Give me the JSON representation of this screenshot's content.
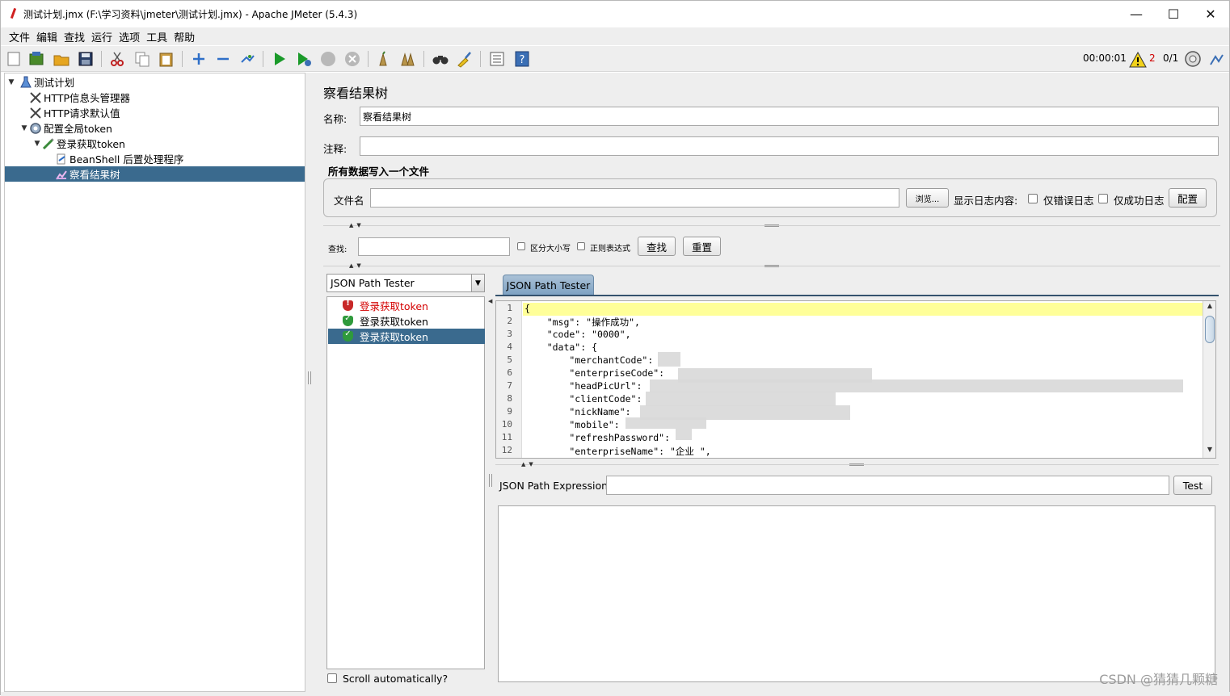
{
  "window": {
    "title": "测试计划.jmx (F:\\学习资料\\jmeter\\测试计划.jmx) - Apache JMeter (5.4.3)",
    "minimize": "—",
    "maximize": "☐",
    "close": "✕"
  },
  "menubar": [
    "文件",
    "编辑",
    "查找",
    "运行",
    "选项",
    "工具",
    "帮助"
  ],
  "toolbar": {
    "icons": [
      "new-icon",
      "templates-icon",
      "open-icon",
      "save-icon",
      "cut-icon",
      "copy-icon",
      "paste-icon",
      "expand-icon",
      "collapse-icon",
      "toggle-icon",
      "start-icon",
      "start-no-pause-icon",
      "stop-icon",
      "shutdown-icon",
      "clear-icon",
      "clear-all-icon",
      "search-icon",
      "reset-search-icon",
      "function-helper-icon",
      "help-icon"
    ],
    "timer": "00:00:01",
    "warning_count": "2",
    "threads": "0/1",
    "colors": {
      "run_green": "#1a9a2a",
      "selection": "#3a6a8e",
      "error_red": "#d40000"
    }
  },
  "tree": [
    {
      "label": "测试计划",
      "icon": "test-plan-icon",
      "toggle": "▼",
      "level": 0
    },
    {
      "label": "HTTP信息头管理器",
      "icon": "config-tool-icon",
      "toggle": "",
      "level": 1
    },
    {
      "label": "HTTP请求默认值",
      "icon": "config-tool-icon",
      "toggle": "",
      "level": 1
    },
    {
      "label": "配置全局token",
      "icon": "gear-icon",
      "toggle": "▼",
      "level": 1
    },
    {
      "label": "登录获取token",
      "icon": "sampler-icon",
      "toggle": "▼",
      "level": 2
    },
    {
      "label": "BeanShell 后置处理程序",
      "icon": "post-processor-icon",
      "toggle": "",
      "level": 3
    },
    {
      "label": "察看结果树",
      "icon": "listener-icon",
      "toggle": "",
      "level": 3,
      "selected": true
    }
  ],
  "panel": {
    "title": "察看结果树",
    "name_label": "名称:",
    "name_value": "察看结果树",
    "comment_label": "注释:",
    "comment_value": "",
    "file_group_title": "所有数据写入一个文件",
    "filename_label": "文件名",
    "filename_value": "",
    "browse_button": "浏览...",
    "log_content_label": "显示日志内容:",
    "errors_only_label": "仅错误日志",
    "success_only_label": "仅成功日志",
    "configure_button": "配置",
    "search_label": "查找:",
    "search_value": "",
    "case_sensitive_label": "区分大小写",
    "regex_label": "正则表达式",
    "find_button": "查找",
    "reset_button": "重置"
  },
  "renderer": {
    "selected": "JSON Path Tester",
    "tab_label": "JSON Path Tester"
  },
  "results": [
    {
      "label": "登录获取token",
      "status": "fail"
    },
    {
      "label": "登录获取token",
      "status": "ok"
    },
    {
      "label": "登录获取token",
      "status": "ok",
      "selected": true
    }
  ],
  "scroll_auto_label": "Scroll automatically?",
  "code": [
    {
      "n": "1",
      "text": "{"
    },
    {
      "n": "2",
      "text": "    \"msg\": \"操作成功\","
    },
    {
      "n": "3",
      "text": "    \"code\": \"0000\","
    },
    {
      "n": "4",
      "text": "    \"data\": {"
    },
    {
      "n": "5",
      "text": "        \"merchantCode\":"
    },
    {
      "n": "6",
      "text": "        \"enterpriseCode\":"
    },
    {
      "n": "7",
      "text": "        \"headPicUrl\":"
    },
    {
      "n": "8",
      "text": "        \"clientCode\":"
    },
    {
      "n": "9",
      "text": "        \"nickName\":"
    },
    {
      "n": "10",
      "text": "        \"mobile\":"
    },
    {
      "n": "11",
      "text": "        \"refreshPassword\":"
    },
    {
      "n": "12",
      "text": "        \"enterpriseName\": \"企业 \","
    }
  ],
  "jsonpath": {
    "label": "JSON Path Expression",
    "value": "",
    "test_button": "Test"
  },
  "watermark": "CSDN @猜猜几颗糖"
}
